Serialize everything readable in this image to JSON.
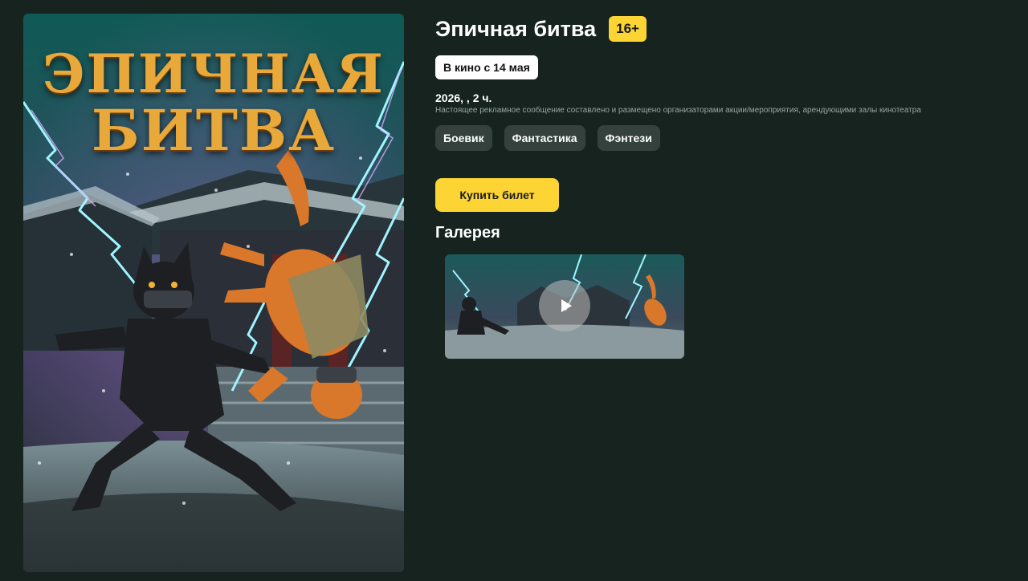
{
  "movie": {
    "title": "Эпичная битва",
    "age_rating": "16+",
    "release_label": "В кино с 14 мая",
    "meta": "2026, , 2 ч.",
    "disclaimer": "Настоящее рекламное сообщение составлено и размещено организаторами акции/мероприятия, арендующими залы кинотеатра",
    "genres": [
      "Боевик",
      "Фантастика",
      "Фэнтези"
    ]
  },
  "poster": {
    "title_line1": "ЭПИЧНАЯ",
    "title_line2": "БИТВА"
  },
  "actions": {
    "buy_label": "Купить билет"
  },
  "gallery": {
    "heading": "Галерея",
    "items": [
      {
        "type": "video",
        "icon": "play-icon"
      }
    ]
  },
  "colors": {
    "background": "#16231f",
    "accent": "#fcd535",
    "genre_chip": "#34413d"
  }
}
